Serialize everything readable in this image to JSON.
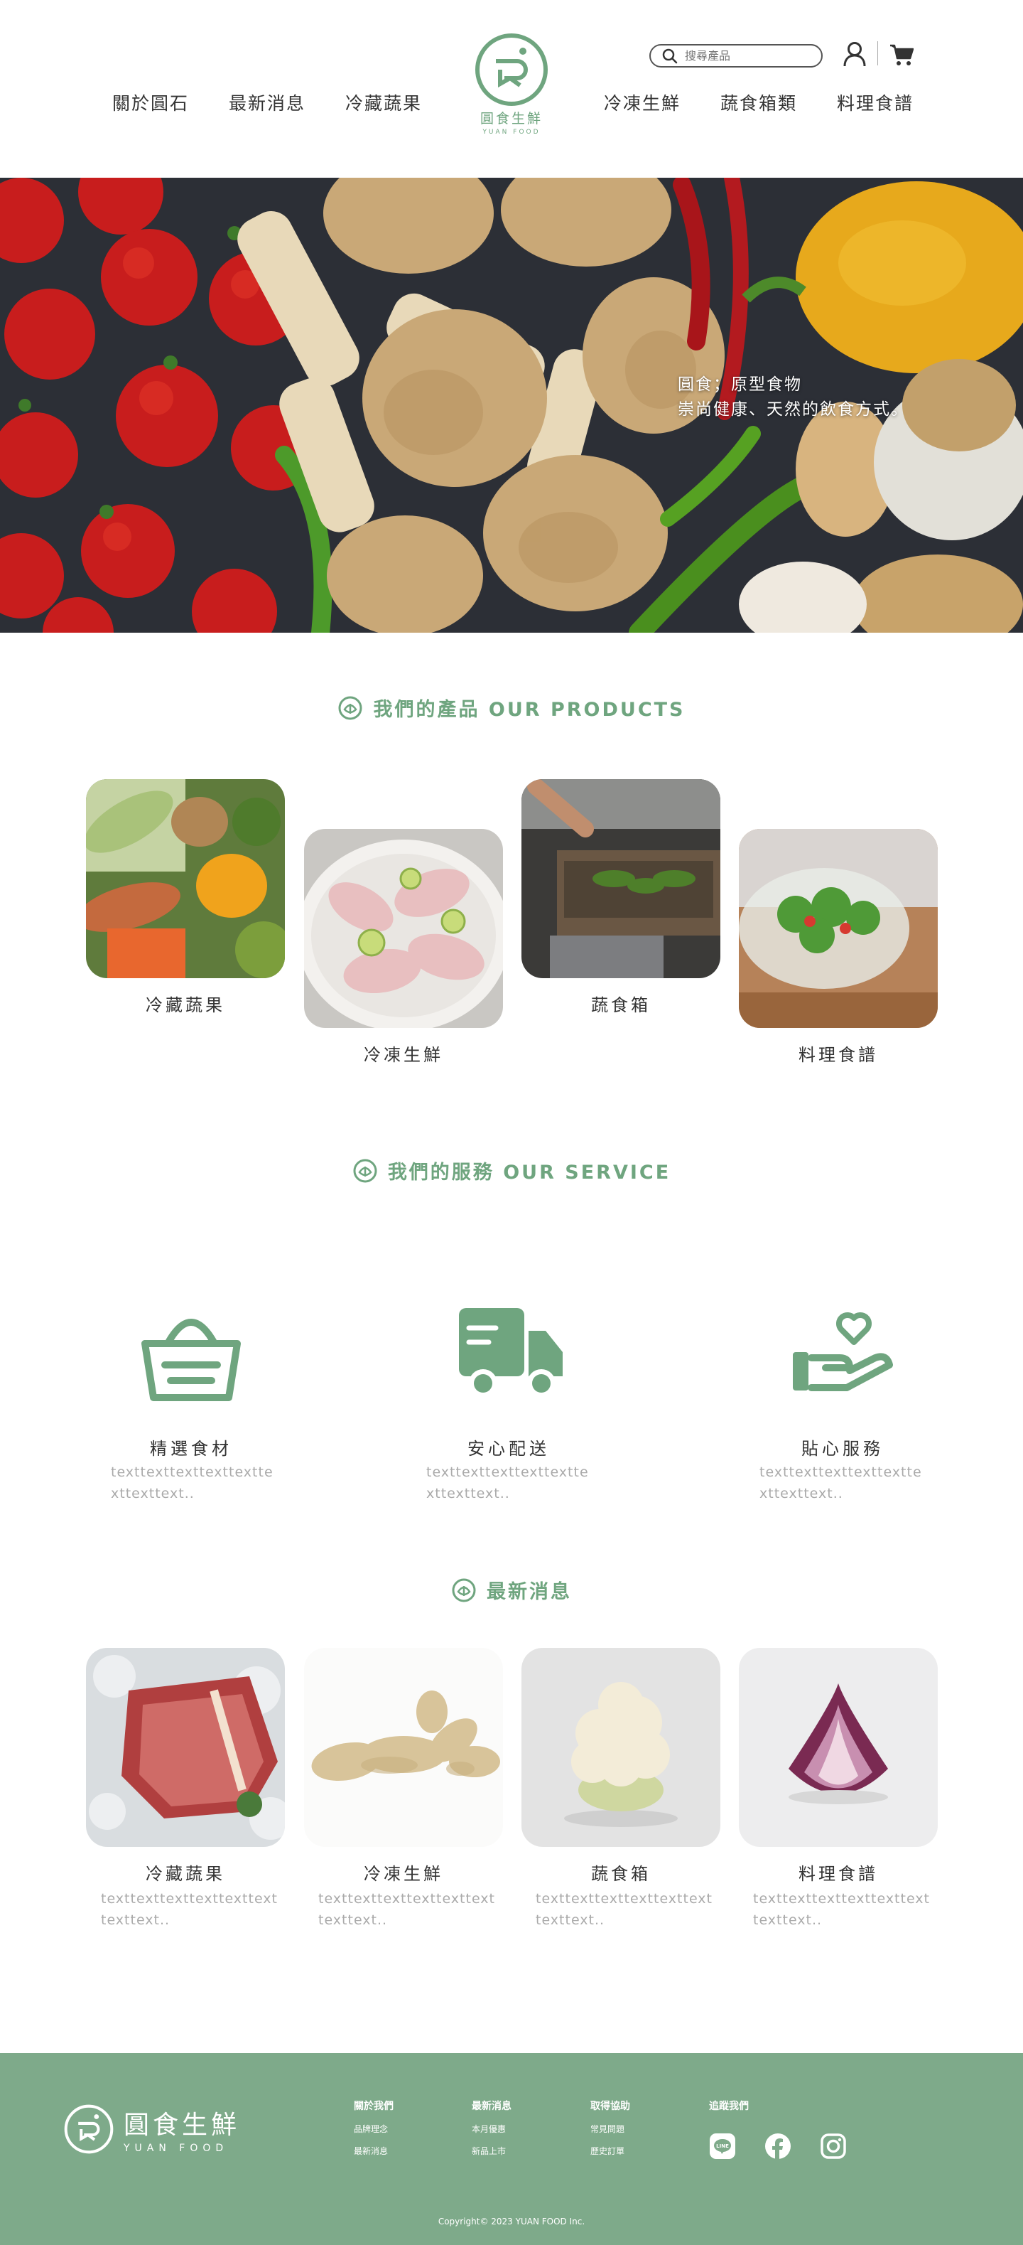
{
  "nav": {
    "left": [
      "關於圓石",
      "最新消息",
      "冷藏蔬果"
    ],
    "right": [
      "冷凍生鮮",
      "蔬食箱類",
      "料理食譜"
    ]
  },
  "logo": {
    "cn": "圓食生鮮",
    "en": "YUAN FOOD"
  },
  "search": {
    "placeholder": "搜尋產品"
  },
  "hero": {
    "line1": "圓食；原型食物",
    "line2": "崇尚健康、天然的飲食方式。"
  },
  "products": {
    "title": "我們的產品 OUR PRODUCTS",
    "items": [
      "冷藏蔬果",
      "冷凍生鮮",
      "蔬食箱",
      "料理食譜"
    ]
  },
  "service": {
    "title": "我們的服務 OUR SERVICE",
    "items": [
      {
        "label": "精選食材",
        "desc": "texttexttexttexttexttexttexttext.."
      },
      {
        "label": "安心配送",
        "desc": "texttexttexttexttexttexttexttext.."
      },
      {
        "label": "貼心服務",
        "desc": "texttexttexttexttexttexttexttext.."
      }
    ]
  },
  "news": {
    "title": "最新消息",
    "items": [
      {
        "label": "冷藏蔬果",
        "desc": "texttexttexttexttexttexttexttext.."
      },
      {
        "label": "冷凍生鮮",
        "desc": "texttexttexttexttexttexttexttext.."
      },
      {
        "label": "蔬食箱",
        "desc": "texttexttexttexttexttexttexttext.."
      },
      {
        "label": "料理食譜",
        "desc": "texttexttexttexttexttexttexttext.."
      }
    ]
  },
  "footer": {
    "logo_cn": "圓食生鮮",
    "logo_en": "YUAN FOOD",
    "cols": [
      {
        "heading": "關於我們",
        "links": [
          "品牌理念",
          "最新消息"
        ]
      },
      {
        "heading": "最新消息",
        "links": [
          "本月優惠",
          "新品上市"
        ]
      },
      {
        "heading": "取得協助",
        "links": [
          "常見問題",
          "歷史訂單"
        ]
      },
      {
        "heading": "追蹤我們",
        "links": []
      }
    ],
    "copyright": "Copyright© 2023 YUAN FOOD Inc."
  },
  "colors": {
    "accent": "#6fa57f",
    "footer_bg": "#7eaa8a"
  },
  "icons": [
    "search-icon",
    "user-icon",
    "cart-icon",
    "basket-icon",
    "truck-icon",
    "heart-hand-icon",
    "line-icon",
    "facebook-icon",
    "instagram-icon"
  ]
}
